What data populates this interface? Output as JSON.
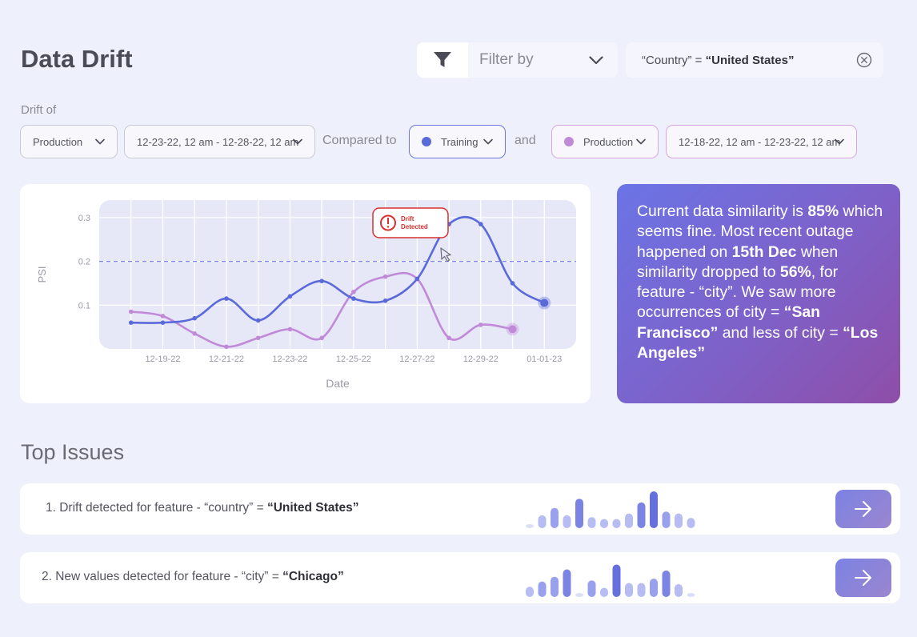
{
  "page": {
    "title": "Data Drift"
  },
  "filter": {
    "label": "Filter by",
    "chip_key": "“Country” = ",
    "chip_value": "“United States”"
  },
  "controls": {
    "drift_of_label": "Drift of",
    "source": "Production",
    "source_range": "12-23-22, 12 am - 12-28-22, 12 am",
    "compared_to_label": "Compared to",
    "baseline_1": "Training",
    "and_label": "and",
    "baseline_2": "Production",
    "baseline_range": "12-18-22, 12 am - 12-23-22, 12 am"
  },
  "colors": {
    "training": "#5b6ad9",
    "production": "#c08ad8",
    "alert": "#d9302f",
    "threshold": "#7d86e6"
  },
  "chart_data": {
    "type": "line",
    "xlabel": "Date",
    "ylabel": "PSI",
    "x_tick_labels": [
      "12-19-22",
      "12-21-22",
      "12-23-22",
      "12-25-22",
      "12-27-22",
      "12-29-22",
      "01-01-23"
    ],
    "y_ticks": [
      0.1,
      0.2,
      0.3
    ],
    "ylim": [
      0,
      0.34
    ],
    "threshold": 0.2,
    "annotation": "Drift Detected",
    "grid": true,
    "series": [
      {
        "key": "training",
        "x": [
          18.0,
          19.0,
          20.0,
          21.0,
          22.0,
          23.0,
          24.0,
          25.0,
          26.0,
          27.0,
          28.0,
          29.0,
          30.0,
          31.0
        ],
        "y": [
          0.06,
          0.06,
          0.07,
          0.115,
          0.065,
          0.12,
          0.155,
          0.115,
          0.11,
          0.16,
          0.285,
          0.285,
          0.15,
          0.105
        ]
      },
      {
        "key": "production",
        "x": [
          18.0,
          19.0,
          20.0,
          21.0,
          22.0,
          23.0,
          24.0,
          25.0,
          26.0,
          27.0,
          28.0,
          29.0,
          30.0
        ],
        "y": [
          0.085,
          0.075,
          0.035,
          0.005,
          0.025,
          0.045,
          0.025,
          0.13,
          0.165,
          0.16,
          0.025,
          0.055,
          0.045
        ]
      }
    ]
  },
  "insight": {
    "t1": "Current data similarity is ",
    "b1": "85%",
    "t2": " which seems fine. Most recent outage happened on ",
    "b2": "15th Dec",
    "t3": " when similarity dropped to ",
    "b3": "56%",
    "t4": ", for feature - “city”. We saw more occurrences of city = ",
    "b4": "“San Francisco”",
    "t5": " and less of city = ",
    "b5": "“Los Angeles”"
  },
  "top_issues": {
    "heading": "Top Issues",
    "items": [
      {
        "prefix": "1. Drift detected for feature - “country” = ",
        "value": "“United States”",
        "bars": [
          0.1,
          0.35,
          0.55,
          0.35,
          0.8,
          0.3,
          0.25,
          0.25,
          0.4,
          0.7,
          1.0,
          0.45,
          0.4,
          0.28
        ]
      },
      {
        "prefix": "2. New values detected for feature - “city” = ",
        "value": "“Chicago”",
        "bars": [
          0.28,
          0.42,
          0.55,
          0.75,
          0.1,
          0.45,
          0.25,
          0.88,
          0.38,
          0.38,
          0.5,
          0.72,
          0.35,
          0.1
        ]
      }
    ]
  }
}
